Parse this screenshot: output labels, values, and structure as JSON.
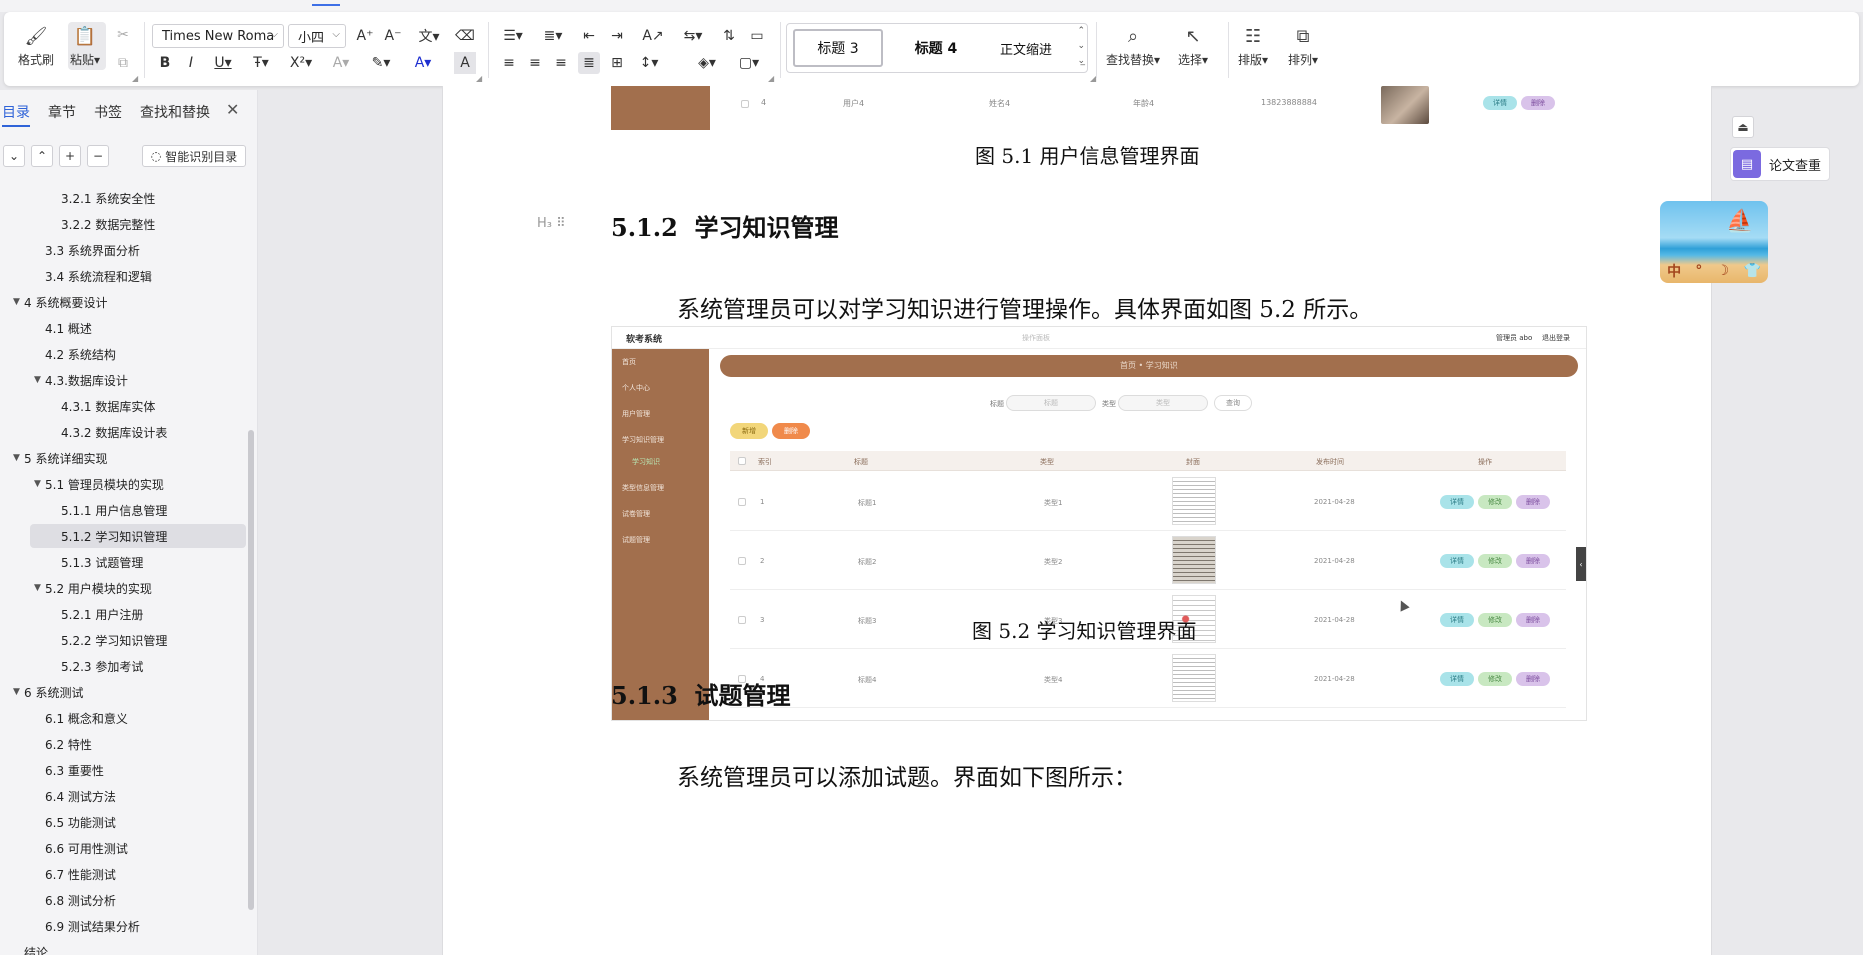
{
  "ribbon": {
    "format_painter": "格式刷",
    "paste": "粘贴",
    "font_name": "Times New Roma",
    "font_size": "小四",
    "styles": [
      "标题 3",
      "标题 4",
      "正文缩进"
    ],
    "find_replace": "查找替换",
    "select": "选择",
    "arrange": "排版",
    "sort": "排列"
  },
  "nav": {
    "tabs": [
      "目录",
      "章节",
      "书签",
      "查找和替换"
    ],
    "smart_toc": "智能识别目录",
    "toc": [
      {
        "label": "3.2.1  系统安全性",
        "level": 3
      },
      {
        "label": "3.2.2  数据完整性",
        "level": 3
      },
      {
        "label": "3.3 系统界面分析",
        "level": 2
      },
      {
        "label": "3.4 系统流程和逻辑",
        "level": 2
      },
      {
        "label": "4 系统概要设计",
        "level": 1,
        "expanded": true
      },
      {
        "label": "4.1 概述",
        "level": 2
      },
      {
        "label": "4.2 系统结构",
        "level": 2
      },
      {
        "label": "4.3.数据库设计",
        "level": 2,
        "expanded": true
      },
      {
        "label": "4.3.1 数据库实体",
        "level": 3
      },
      {
        "label": "4.3.2 数据库设计表",
        "level": 3
      },
      {
        "label": "5 系统详细实现",
        "level": 1,
        "expanded": true
      },
      {
        "label": "5.1  管理员模块的实现",
        "level": 2,
        "expanded": true
      },
      {
        "label": "5.1.1  用户信息管理",
        "level": 3
      },
      {
        "label": "5.1.2  学习知识管理",
        "level": 3,
        "selected": true
      },
      {
        "label": "5.1.3  试题管理",
        "level": 3
      },
      {
        "label": "5.2  用户模块的实现",
        "level": 2,
        "expanded": true
      },
      {
        "label": "5.2.1  用户注册",
        "level": 3
      },
      {
        "label": "5.2.2  学习知识管理",
        "level": 3
      },
      {
        "label": "5.2.3  参加考试",
        "level": 3
      },
      {
        "label": "6 系统测试",
        "level": 1,
        "expanded": true
      },
      {
        "label": "6.1 概念和意义",
        "level": 2
      },
      {
        "label": "6.2 特性",
        "level": 2
      },
      {
        "label": "6.3 重要性",
        "level": 2
      },
      {
        "label": "6.4 测试方法",
        "level": 2
      },
      {
        "label": "6.5  功能测试",
        "level": 2
      },
      {
        "label": "6.6 可用性测试",
        "level": 2
      },
      {
        "label": "6.7 性能测试",
        "level": 2
      },
      {
        "label": "6.8 测试分析",
        "level": 2
      },
      {
        "label": "6.9 测试结果分析",
        "level": 2
      },
      {
        "label": "结论",
        "level": 1
      }
    ]
  },
  "doc": {
    "caption_1": "图 5.1 用户信息管理界面",
    "heading_512_num": "5.1.2",
    "heading_512_text": "学习知识管理",
    "para_512": "系统管理员可以对学习知识进行管理操作。具体界面如图 5.2 所示。",
    "caption_2": "图 5.2  学习知识管理界面",
    "heading_513_num": "5.1.3",
    "heading_513_text": "试题管理",
    "para_513": "系统管理员可以添加试题。界面如下图所示：",
    "heading_marker": "H₃"
  },
  "fragment": {
    "cells": [
      "4",
      "用户4",
      "姓名4",
      "年龄4",
      "13823888884"
    ],
    "btn_detail": "详情",
    "btn_delete": "删除"
  },
  "shot": {
    "app_title": "软考系统",
    "top_center": "操作面板",
    "top_admin": "管理员 abo",
    "top_logout": "退出登录",
    "banner": "首页 • 学习知识",
    "side": [
      "首页",
      "个人中心",
      "用户管理",
      "学习知识管理",
      "学习知识",
      "类型信息管理",
      "试卷管理",
      "试题管理"
    ],
    "filter_title": "标题",
    "filter_title_ph": "标题",
    "filter_type": "类型",
    "filter_type_ph": "类型",
    "btn_query": "查询",
    "btn_add": "新增",
    "btn_remove": "删除",
    "headers": [
      "索引",
      "标题",
      "类型",
      "封面",
      "发布时间",
      "操作"
    ],
    "rows": [
      {
        "idx": "1",
        "title": "标题1",
        "type": "类型1",
        "date": "2021-04-28"
      },
      {
        "idx": "2",
        "title": "标题2",
        "type": "类型2",
        "date": "2021-04-28"
      },
      {
        "idx": "3",
        "title": "标题3",
        "type": "类型3",
        "date": "2021-04-28"
      },
      {
        "idx": "4",
        "title": "标题4",
        "type": "类型4",
        "date": "2021-04-28"
      }
    ],
    "row_btns": [
      "详情",
      "修改",
      "删除"
    ]
  },
  "right": {
    "paper_check": "论文查重",
    "ime": [
      "中",
      "°",
      "☽",
      "👕"
    ]
  },
  "colors": {
    "accent": "#2f63d8",
    "brand_brown": "#a26f4d"
  }
}
